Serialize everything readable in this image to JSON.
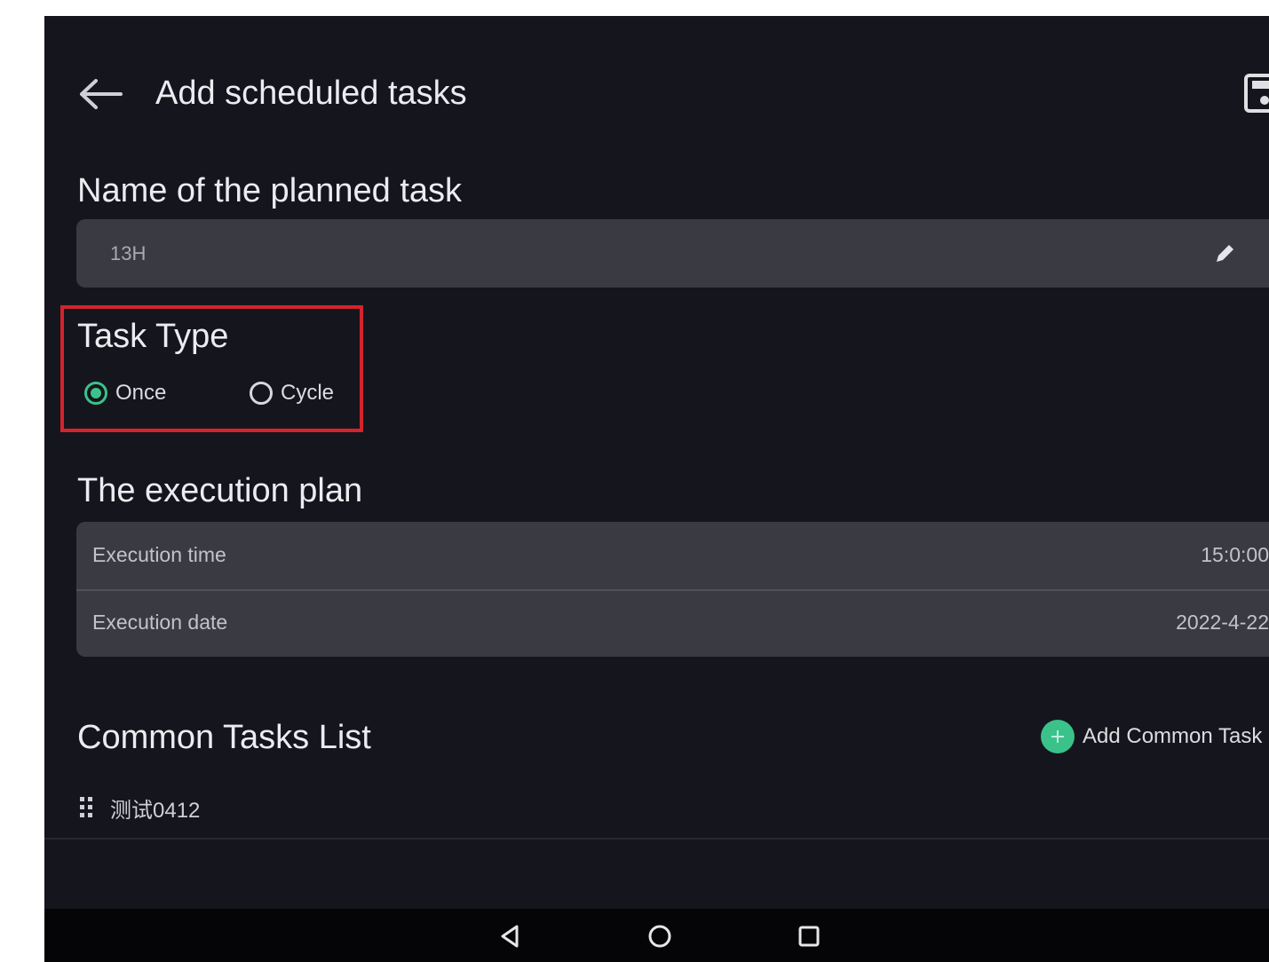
{
  "header": {
    "title": "Add scheduled tasks",
    "back_icon": "arrow-left-icon",
    "save_icon": "save-icon"
  },
  "task_name": {
    "label": "Name of the planned task",
    "value": "13H",
    "edit_icon": "pencil-icon"
  },
  "task_type": {
    "label": "Task Type",
    "options": [
      {
        "label": "Once",
        "selected": true
      },
      {
        "label": "Cycle",
        "selected": false
      }
    ],
    "highlight_color": "#d3242d"
  },
  "execution_plan": {
    "label": "The execution plan",
    "rows": [
      {
        "key": "Execution time",
        "value": "15:0:00"
      },
      {
        "key": "Execution date",
        "value": "2022-4-22"
      }
    ]
  },
  "common_tasks": {
    "label": "Common Tasks List",
    "add_button_label": "Add Common Task",
    "items": [
      {
        "label": "测试0412"
      }
    ]
  },
  "colors": {
    "accent": "#3ac28a",
    "background": "#15151d",
    "card": "#3a3b42"
  },
  "nav_bar": {
    "back": "triangle-back-icon",
    "home": "circle-home-icon",
    "recents": "square-recents-icon"
  }
}
